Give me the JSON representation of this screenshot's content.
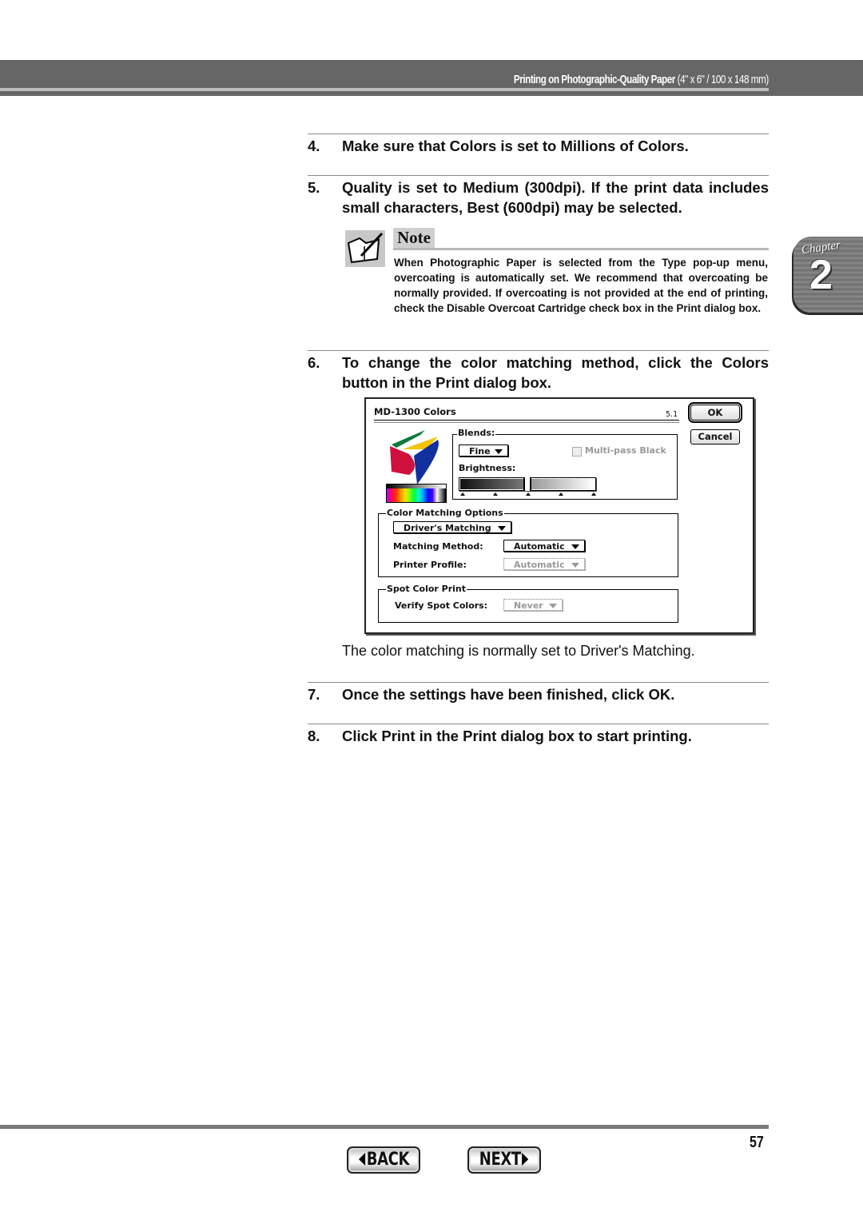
{
  "header": {
    "title": "Printing on Photographic-Quality Paper",
    "dimensions": " (4\" x 6\" / 100 x 148 mm)"
  },
  "chapter_tab": {
    "word": "Chapter",
    "number": "2"
  },
  "steps": [
    {
      "num": "4.",
      "text": "Make sure that Colors is set to Millions of Colors."
    },
    {
      "num": "5.",
      "text": "Quality is set to Medium (300dpi). If the print data includes small characters, Best (600dpi) may be selected."
    },
    {
      "num": "6.",
      "text": "To change the color matching method, click the Colors button in the Print dialog box."
    },
    {
      "num": "7.",
      "text": "Once the settings have been finished, click OK."
    },
    {
      "num": "8.",
      "text": "Click Print in the Print dialog box to start printing."
    }
  ],
  "note": {
    "label": "Note",
    "icon": "note-pencil-book-icon",
    "body": "When Photographic Paper is selected from the Type pop-up menu, overcoating is automatically set. We recommend that overcoating be normally provided. If overcoating is not provided at the end of printing, check the Disable Overcoat Cartridge check box in the Print dialog box."
  },
  "dialog": {
    "title": "MD-1300 Colors",
    "version": "5.1",
    "ok_label": "OK",
    "cancel_label": "Cancel",
    "blends": {
      "label": "Blends:",
      "selected": "Fine",
      "multipass_label": "Multi-pass Black",
      "multipass_checked": false,
      "multipass_enabled": false
    },
    "brightness": {
      "label": "Brightness:",
      "value_fraction": 0.5,
      "tick_count": 5
    },
    "color_matching": {
      "group_label": "Color Matching Options",
      "mode_selected": "Driver's Matching",
      "method_label": "Matching Method:",
      "method_selected": "Automatic",
      "profile_label": "Printer Profile:",
      "profile_selected": "Automatic",
      "profile_enabled": false
    },
    "spot_color": {
      "group_label": "Spot Color Print",
      "verify_label": "Verify Spot Colors:",
      "verify_selected": "Never",
      "verify_enabled": false
    }
  },
  "caption": "The color matching is normally set to Driver's Matching.",
  "footer": {
    "page_number": "57",
    "back_label": "BACK",
    "next_label": "NEXT"
  }
}
